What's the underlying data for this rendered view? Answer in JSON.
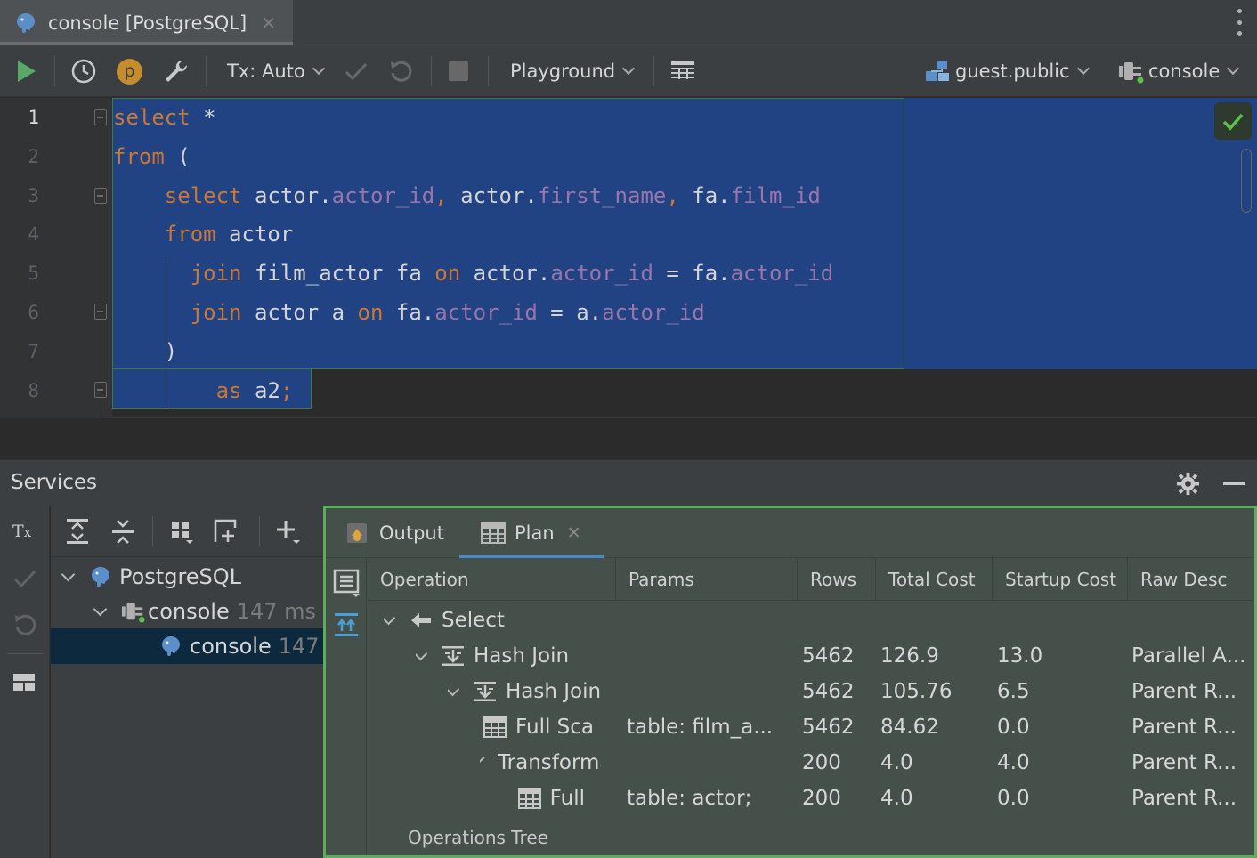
{
  "tab": {
    "title": "console [PostgreSQL]",
    "close": "✕"
  },
  "toolbar": {
    "tx_label": "Tx: Auto",
    "playground_label": "Playground",
    "schema_label": "guest.public",
    "session_label": "console",
    "p_badge": "p"
  },
  "editor": {
    "line_numbers": [
      "1",
      "2",
      "3",
      "4",
      "5",
      "6",
      "7",
      "8"
    ],
    "lines": [
      [
        {
          "t": "select",
          "c": "kw"
        },
        {
          "t": " *",
          "c": ""
        }
      ],
      [
        {
          "t": "from",
          "c": "kw"
        },
        {
          "t": " (",
          "c": ""
        }
      ],
      [
        {
          "t": "    ",
          "c": ""
        },
        {
          "t": "select",
          "c": "kw"
        },
        {
          "t": " actor.",
          "c": ""
        },
        {
          "t": "actor_id",
          "c": "fld"
        },
        {
          "t": ", ",
          "c": "kw"
        },
        {
          "t": "actor.",
          "c": ""
        },
        {
          "t": "first_name",
          "c": "fld"
        },
        {
          "t": ", ",
          "c": "kw"
        },
        {
          "t": "fa.",
          "c": ""
        },
        {
          "t": "film_id",
          "c": "fld"
        }
      ],
      [
        {
          "t": "    ",
          "c": ""
        },
        {
          "t": "from",
          "c": "kw"
        },
        {
          "t": " actor",
          "c": ""
        }
      ],
      [
        {
          "t": "      ",
          "c": ""
        },
        {
          "t": "join",
          "c": "kw"
        },
        {
          "t": " film_actor fa ",
          "c": ""
        },
        {
          "t": "on",
          "c": "kw"
        },
        {
          "t": " actor.",
          "c": ""
        },
        {
          "t": "actor_id",
          "c": "fld"
        },
        {
          "t": " = fa.",
          "c": ""
        },
        {
          "t": "actor_id",
          "c": "fld"
        }
      ],
      [
        {
          "t": "      ",
          "c": ""
        },
        {
          "t": "join",
          "c": "kw"
        },
        {
          "t": " actor a ",
          "c": ""
        },
        {
          "t": "on",
          "c": "kw"
        },
        {
          "t": " fa.",
          "c": ""
        },
        {
          "t": "actor_id",
          "c": "fld"
        },
        {
          "t": " = a.",
          "c": ""
        },
        {
          "t": "actor_id",
          "c": "fld"
        }
      ],
      [
        {
          "t": "    )",
          "c": ""
        }
      ],
      [
        {
          "t": "        ",
          "c": ""
        },
        {
          "t": "as",
          "c": "kw"
        },
        {
          "t": " a2",
          "c": ""
        },
        {
          "t": ";",
          "c": "kw"
        }
      ]
    ]
  },
  "services": {
    "title": "Services",
    "tree": [
      {
        "label": "PostgreSQL",
        "extra": ""
      },
      {
        "label": "console",
        "extra": "147 ms"
      },
      {
        "label": "console",
        "extra": "147"
      }
    ]
  },
  "plan": {
    "tabs": [
      {
        "label": "Output"
      },
      {
        "label": "Plan",
        "close": "✕"
      }
    ],
    "columns": [
      "Operation",
      "Params",
      "Rows",
      "Total Cost",
      "Startup Cost",
      "Raw Desc"
    ],
    "rows": [
      {
        "op": "Select",
        "params": "",
        "rows": "",
        "total": "",
        "startup": "",
        "raw": ""
      },
      {
        "op": "Hash Join",
        "params": "",
        "rows": "5462",
        "total": "126.9",
        "startup": "13.0",
        "raw": "Parallel A..."
      },
      {
        "op": "Hash Join",
        "params": "",
        "rows": "5462",
        "total": "105.76",
        "startup": "6.5",
        "raw": "Parent R..."
      },
      {
        "op": "Full Sca",
        "params": "table: film_a...",
        "rows": "5462",
        "total": "84.62",
        "startup": "0.0",
        "raw": "Parent R..."
      },
      {
        "op": "Transforma",
        "params": "",
        "rows": "200",
        "total": "4.0",
        "startup": "4.0",
        "raw": "Parent R..."
      },
      {
        "op": "Full",
        "params": "table: actor;",
        "rows": "200",
        "total": "4.0",
        "startup": "0.0",
        "raw": "Parent R..."
      }
    ],
    "caption": "Operations Tree"
  },
  "colors": {
    "selection": "#214283",
    "keyword": "#cc7832",
    "field": "#9876aa",
    "panel_border": "#59b059",
    "run_green": "#59a869"
  },
  "icons": [
    "postgresql-icon",
    "close-icon",
    "more-icon",
    "run-icon",
    "history-icon",
    "p-badge-icon",
    "settings-wrench-icon",
    "commit-icon",
    "rollback-icon",
    "stop-icon",
    "table-view-icon",
    "schema-icon",
    "session-icon",
    "check-icon",
    "gear-icon",
    "minimize-icon",
    "output-icon",
    "plan-grid-icon",
    "expand-all-icon",
    "collapse-all-icon",
    "group-icon",
    "add-icon",
    "layout-icon"
  ]
}
